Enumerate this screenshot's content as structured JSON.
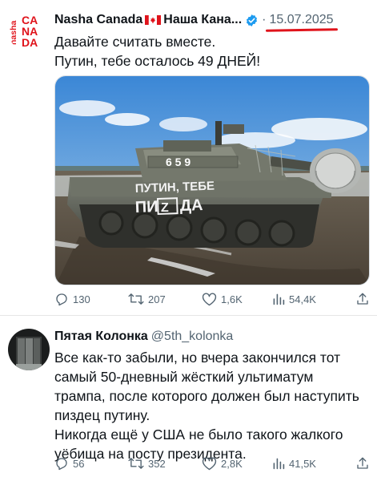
{
  "tweet1": {
    "display_name": "Nasha Canada",
    "display_name_cyrillic": "Наша Кана...",
    "avatar_text": [
      "nasha",
      "CA",
      "NA",
      "DA"
    ],
    "date": "15.07.2025",
    "text": "Давайте считать вместе.\nПутин, тебе осталось 49 ДНЕЙ!",
    "image_texts": {
      "turret_number": "6 5 9",
      "graffiti_line1": "ПУТИН, ТЕБЕ",
      "graffiti_line2a": "ПИ",
      "graffiti_line2b": "ДА"
    },
    "stats": {
      "replies": "130",
      "reposts": "207",
      "likes": "1,6K",
      "views": "54,4K"
    }
  },
  "tweet2": {
    "display_name": "Пятая Колонка",
    "handle": "@5th_kolonka",
    "text": "Все как-то забыли, но вчера закончился тот\nсамый 50-дневный жёсткий ультиматум\nтрампа, после которого должен был наступить\nпиздец путину.\nНикогда ещё у США не было такого жалкого\nуёбища на посту президента.",
    "stats": {
      "replies": "56",
      "reposts": "352",
      "likes": "2,8K",
      "views": "41,5K"
    }
  },
  "colors": {
    "text": "#0f1419",
    "secondary": "#536471",
    "verified": "#1d9bf0",
    "underline": "#e0131b",
    "avatar_red": "#e0131b"
  }
}
